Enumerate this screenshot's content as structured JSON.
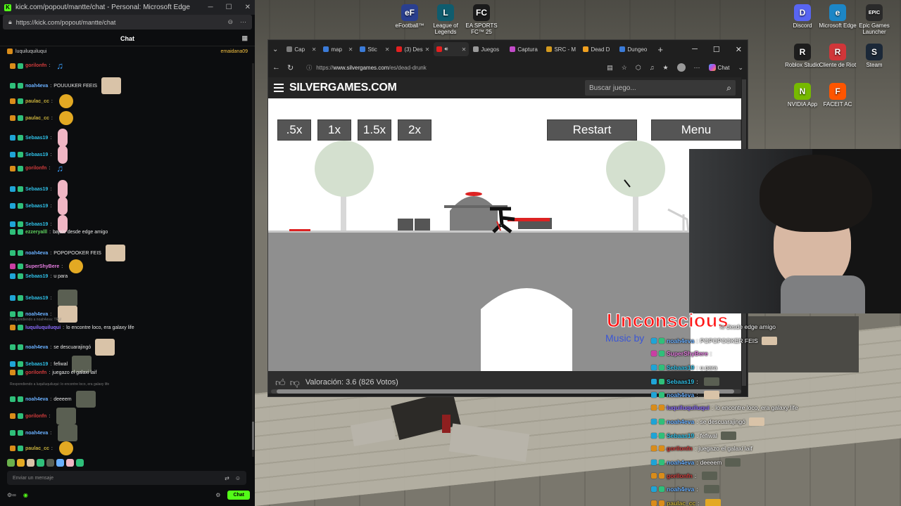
{
  "desktop": {
    "icons": [
      {
        "label": "eFootball™",
        "color": "#2a3f8f",
        "glyph": "eF",
        "name": "efootball-icon"
      },
      {
        "label": "League of Legends",
        "color": "#0f5c6e",
        "glyph": "L",
        "name": "league-of-legends-icon"
      },
      {
        "label": "EA SPORTS FC™ 25",
        "color": "#1b1b1b",
        "glyph": "FC",
        "name": "ea-sports-fc-icon"
      },
      {
        "label": "Discord",
        "color": "#5865f2",
        "glyph": "D",
        "name": "discord-icon"
      },
      {
        "label": "Microsoft Edge",
        "color": "#1c86c6",
        "glyph": "e",
        "name": "edge-icon"
      },
      {
        "label": "Epic Games Launcher",
        "color": "#2a2a2a",
        "glyph": "EPIC",
        "name": "epic-games-icon"
      },
      {
        "label": "Roblox Studio",
        "color": "#1d1d1d",
        "glyph": "R",
        "name": "roblox-studio-icon"
      },
      {
        "label": "Cliente de Riot",
        "color": "#d13639",
        "glyph": "R",
        "name": "riot-client-icon"
      },
      {
        "label": "Steam",
        "color": "#1b2838",
        "glyph": "S",
        "name": "steam-icon"
      },
      {
        "label": "NVIDIA App",
        "color": "#76b900",
        "glyph": "N",
        "name": "nvidia-app-icon"
      },
      {
        "label": "FACEIT AC",
        "color": "#ff5500",
        "glyph": "F",
        "name": "faceit-icon"
      }
    ]
  },
  "kick": {
    "window_title": "kick.com/popout/mantte/chat - Personal: Microsoft Edge",
    "url": "https://kick.com/popout/mantte/chat",
    "chat_header": "Chat",
    "pinned_user": "luquiluquiluqui",
    "pinned_right": "emaidana09",
    "input_placeholder": "Enviar un mensaje",
    "chat_button": "Chat",
    "reply_label_1": "Respondiendo a noah4eva: TRU",
    "reply_label_2": "Respondiendo a luquiluquiluqui: lo encontre loco, era galaxy life",
    "messages": [
      {
        "user": "gorilonfn",
        "text": "",
        "color": "#d03b3b",
        "badge": "b-gold",
        "emote": "e-note"
      },
      {
        "user": "noah4eva",
        "text": "POUUUKER FEEIS",
        "color": "#6ab0ff",
        "badge": "b-green",
        "emote": "e-cat"
      },
      {
        "user": "paulac_cc",
        "text": "",
        "color": "#c9b13c",
        "badge": "b-gold",
        "emote": "e-coin"
      },
      {
        "user": "paulac_cc",
        "text": "",
        "color": "#c9b13c",
        "badge": "b-gold",
        "emote": "e-coin"
      },
      {
        "user": "Sebaas19",
        "text": "",
        "color": "#2fbfe6",
        "badge": "b-cyan",
        "emote": "e-pig"
      },
      {
        "user": "Sebaas19",
        "text": "",
        "color": "#2fbfe6",
        "badge": "b-cyan",
        "emote": "e-pig"
      },
      {
        "user": "gorilonfn",
        "text": "",
        "color": "#d03b3b",
        "badge": "b-gold",
        "emote": "e-note"
      },
      {
        "user": "Sebaas19",
        "text": "",
        "color": "#2fbfe6",
        "badge": "b-cyan",
        "emote": "e-pig"
      },
      {
        "user": "Sebaas19",
        "text": "",
        "color": "#2fbfe6",
        "badge": "b-cyan",
        "emote": "e-pig"
      },
      {
        "user": "Sebaas19",
        "text": "",
        "color": "#2fbfe6",
        "badge": "b-cyan",
        "emote": "e-pig"
      },
      {
        "user": "ezzeryalll",
        "text": "bajale desde edge amigo",
        "color": "#5fd35f",
        "badge": "b-green",
        "emote": ""
      },
      {
        "user": "noah4eva",
        "text": "POPOPOOKER FEIS",
        "color": "#6ab0ff",
        "badge": "b-green",
        "emote": "e-cat"
      },
      {
        "user": "SuperShyBere",
        "text": "",
        "color": "#e57de0",
        "badge": "b-pink",
        "emote": "e-coin"
      },
      {
        "user": "Sebaas19",
        "text": "u para",
        "color": "#2fbfe6",
        "badge": "b-cyan",
        "emote": ""
      },
      {
        "user": "Sebaas19",
        "text": "",
        "color": "#2fbfe6",
        "badge": "b-cyan",
        "emote": "e-gray"
      },
      {
        "user": "noah4eva",
        "text": "",
        "color": "#6ab0ff",
        "badge": "b-green",
        "emote": "e-cat"
      },
      {
        "user": "luquiluquiluqui",
        "text": "lo encontre loco, era galaxy life",
        "color": "#8c6cff",
        "badge": "b-gold",
        "emote": ""
      },
      {
        "user": "noah4eva",
        "text": "se descuarajingó",
        "color": "#6ab0ff",
        "badge": "b-green",
        "emote": "e-cat"
      },
      {
        "user": "Sebaas19",
        "text": "fefiwal",
        "color": "#2fbfe6",
        "badge": "b-cyan",
        "emote": "e-gray"
      },
      {
        "user": "gorilonfn",
        "text": "juegazo el galaxi laif",
        "color": "#d03b3b",
        "badge": "b-gold",
        "emote": ""
      },
      {
        "user": "noah4eva",
        "text": "deeeem",
        "color": "#6ab0ff",
        "badge": "b-green",
        "emote": "e-gray"
      },
      {
        "user": "gorilonfn",
        "text": "",
        "color": "#d03b3b",
        "badge": "b-gold",
        "emote": "e-gray"
      },
      {
        "user": "noah4eva",
        "text": "",
        "color": "#6ab0ff",
        "badge": "b-green",
        "emote": "e-gray"
      },
      {
        "user": "paulac_cc",
        "text": "",
        "color": "#c9b13c",
        "badge": "b-gold",
        "emote": "e-coin"
      }
    ]
  },
  "edge": {
    "tabs": [
      {
        "label": "Cap",
        "color": "#7a7a7a"
      },
      {
        "label": "map",
        "color": "#3b7bd8"
      },
      {
        "label": "Stic",
        "color": "#3b7bd8"
      },
      {
        "label": "(3) Des",
        "color": "#e32020"
      },
      {
        "label": "",
        "color": "#e32020",
        "active": true
      },
      {
        "label": "Juegos",
        "color": "#9a9a9a"
      },
      {
        "label": "Captura",
        "color": "#c34bc9"
      },
      {
        "label": "SRC - M",
        "color": "#d49a1f"
      },
      {
        "label": "Dead D",
        "color": "#f0a020"
      },
      {
        "label": "Dungeo",
        "color": "#3b7bd8"
      }
    ],
    "url_prefix": "https://",
    "url_host": "www.silvergames.com",
    "url_path": "/es/dead-drunk",
    "copilot_label": "Chat"
  },
  "site": {
    "logo": "SILVERGAMES.COM",
    "search_placeholder": "Buscar juego...",
    "rating_text": "Valoración: 3.6 (826 Votos)"
  },
  "game": {
    "speed_buttons": [
      ".5x",
      "1x",
      "1.5x",
      "2x"
    ],
    "restart_label": "Restart",
    "menu_label": "Menu"
  },
  "music": {
    "title": "Unconscious",
    "credit": "Music by"
  },
  "overlay_chat": [
    {
      "user": "",
      "text": "le desde edge amigo",
      "color": "#fff",
      "badges": []
    },
    {
      "user": "noah4eva",
      "text": "POPOPOOKER FEIS",
      "color": "#6ab0ff",
      "badges": [
        "#1fa4d6",
        "#2fbf7a"
      ],
      "thumb": "#d9c3a8"
    },
    {
      "user": "SuperShyBere",
      "text": "",
      "color": "#e57de0",
      "badges": [
        "#c93ea3",
        "#2fbf7a"
      ],
      "thumb": ""
    },
    {
      "user": "Sebaas19",
      "text": "u para",
      "color": "#2fbfe6",
      "badges": [
        "#1fa4d6",
        "#2fbf7a"
      ]
    },
    {
      "user": "Sebaas19",
      "text": "",
      "color": "#2fbfe6",
      "badges": [
        "#1fa4d6",
        "#2fbf7a"
      ],
      "thumb": "#5a5f52"
    },
    {
      "user": "noah4eva",
      "text": "",
      "color": "#6ab0ff",
      "badges": [
        "#1fa4d6",
        "#2fbf7a"
      ],
      "thumb": "#d9c3a8"
    },
    {
      "user": "luquiluquiluqui",
      "text": "lo encontre loco, era galaxy life",
      "color": "#8c6cff",
      "badges": [
        "#d98c1a",
        "#d98c1a"
      ]
    },
    {
      "user": "noah4eva",
      "text": "se descuarajingó",
      "color": "#6ab0ff",
      "badges": [
        "#1fa4d6",
        "#2fbf7a"
      ],
      "thumb": "#d9c3a8"
    },
    {
      "user": "Sebaas19",
      "text": "fefiwal",
      "color": "#2fbfe6",
      "badges": [
        "#1fa4d6",
        "#2fbf7a"
      ],
      "thumb": "#5a5f52"
    },
    {
      "user": "gorilonfn",
      "text": "juegazo el galaxi laif",
      "color": "#d03b3b",
      "badges": [
        "#d98c1a",
        "#d98c1a"
      ]
    },
    {
      "user": "noah4eva",
      "text": "deeeem",
      "color": "#6ab0ff",
      "badges": [
        "#1fa4d6",
        "#2fbf7a"
      ],
      "thumb": "#5a5f52"
    },
    {
      "user": "gorilonfn",
      "text": "",
      "color": "#d03b3b",
      "badges": [
        "#d98c1a",
        "#d98c1a"
      ],
      "thumb": "#5a5f52"
    },
    {
      "user": "noah4eva",
      "text": "",
      "color": "#6ab0ff",
      "badges": [
        "#1fa4d6",
        "#2fbf7a"
      ],
      "thumb": "#5a5f52"
    },
    {
      "user": "paulac_cc",
      "text": "",
      "color": "#c9b13c",
      "badges": [
        "#d98c1a",
        "#d98c1a"
      ],
      "thumb": "#e3a923"
    }
  ]
}
